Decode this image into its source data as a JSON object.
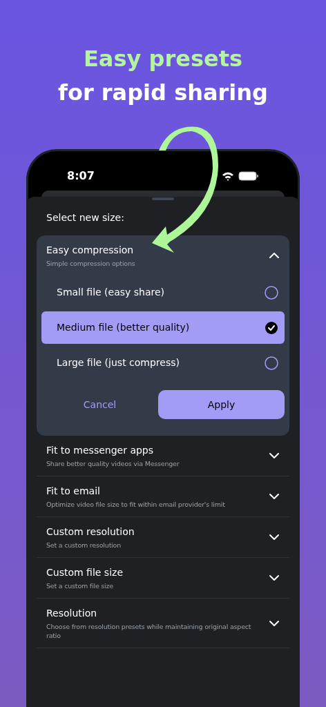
{
  "headline": {
    "highlight": "Easy presets",
    "rest": "for rapid sharing"
  },
  "status_bar": {
    "time": "8:07"
  },
  "sheet": {
    "title": "Select new size:",
    "sections": [
      {
        "title": "Easy compression",
        "subtitle": "Simple compression options",
        "expanded": true,
        "options": [
          {
            "label": "Small file (easy share)",
            "selected": false
          },
          {
            "label": "Medium file (better quality)",
            "selected": true
          },
          {
            "label": "Large file (just compress)",
            "selected": false
          }
        ],
        "cancel": "Cancel",
        "apply": "Apply"
      },
      {
        "title": "Fit to messenger apps",
        "subtitle": "Share better quality videos via Messenger",
        "expanded": false
      },
      {
        "title": "Fit to email",
        "subtitle": "Optimize video file size to fit within email provider's limit",
        "expanded": false
      },
      {
        "title": "Custom resolution",
        "subtitle": "Set a custom resolution",
        "expanded": false
      },
      {
        "title": "Custom file size",
        "subtitle": "Set a custom file size",
        "expanded": false
      },
      {
        "title": "Resolution",
        "subtitle": "Choose from resolution presets while maintaining original aspect ratio",
        "expanded": false
      }
    ]
  }
}
